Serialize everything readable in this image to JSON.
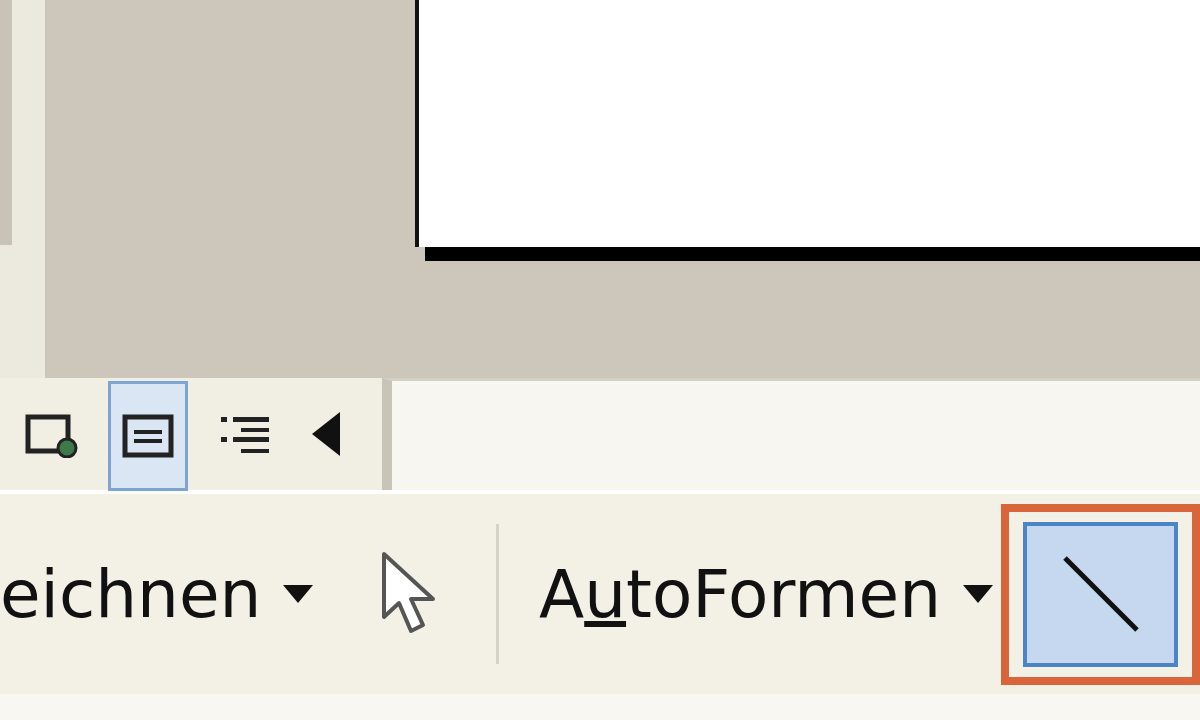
{
  "view_buttons": [
    {
      "kind": "web",
      "selected": false
    },
    {
      "kind": "normal",
      "selected": true
    },
    {
      "kind": "outline",
      "selected": false
    }
  ],
  "drawing_toolbar": [
    {
      "kind": "menu",
      "label": "eichnen"
    },
    {
      "kind": "pointer",
      "selected": false
    },
    {
      "kind": "separator"
    },
    {
      "kind": "menu",
      "label_parts": [
        {
          "text": "A",
          "underlined": false
        },
        {
          "text": "u",
          "underlined": true
        },
        {
          "text": "toFormen",
          "underlined": false
        }
      ]
    },
    {
      "kind": "line",
      "selected": true,
      "highlighted": true
    }
  ]
}
